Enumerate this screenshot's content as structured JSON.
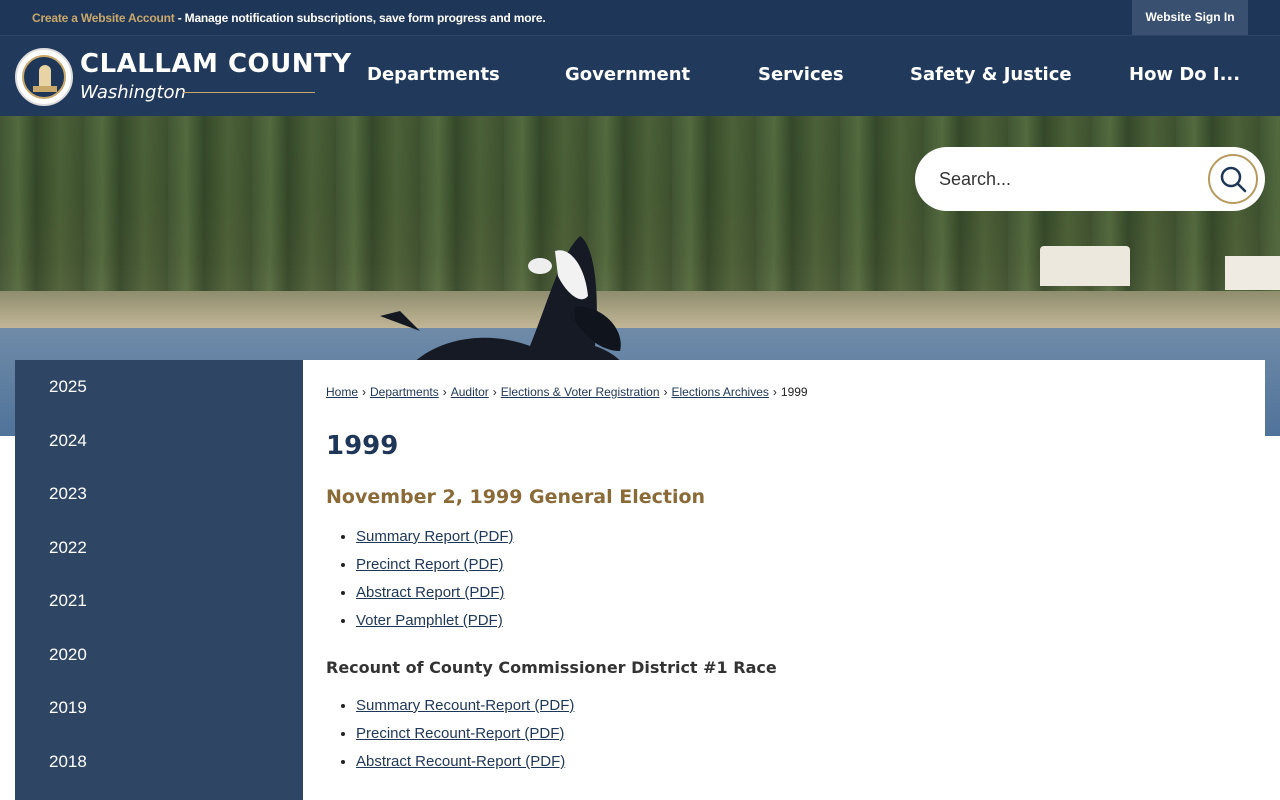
{
  "topbar": {
    "create_account": "Create a Website Account",
    "promo_rest": " - Manage notification subscriptions, save form progress and more.",
    "signin": "Website Sign In"
  },
  "logo": {
    "title": "CLALLAM COUNTY",
    "subtitle": "Washington"
  },
  "nav": [
    "Departments",
    "Government",
    "Services",
    "Safety & Justice",
    "How Do I..."
  ],
  "search": {
    "placeholder": "Search..."
  },
  "sidebar": {
    "items": [
      "2025",
      "2024",
      "2023",
      "2022",
      "2021",
      "2020",
      "2019",
      "2018"
    ]
  },
  "breadcrumb": {
    "links": [
      "Home",
      "Departments",
      "Auditor",
      "Elections & Voter Registration",
      "Elections Archives"
    ],
    "separator": "›",
    "current": "1999"
  },
  "page_title": "1999",
  "general_election": {
    "heading": "November 2, 1999 General Election",
    "links": [
      "Summary Report (PDF)",
      "Precinct Report (PDF)",
      "Abstract Report (PDF)",
      "Voter Pamphlet (PDF)"
    ]
  },
  "recount": {
    "heading": "Recount of County Commissioner District #1 Race",
    "links": [
      "Summary Recount-Report (PDF)",
      "Precinct Recount-Report (PDF)",
      "Abstract Recount-Report (PDF)"
    ]
  },
  "colors": {
    "navy": "#1e3657",
    "sidebar": "#2e4664",
    "gold": "#c9a86c",
    "heading_gold": "#8a6a36"
  }
}
